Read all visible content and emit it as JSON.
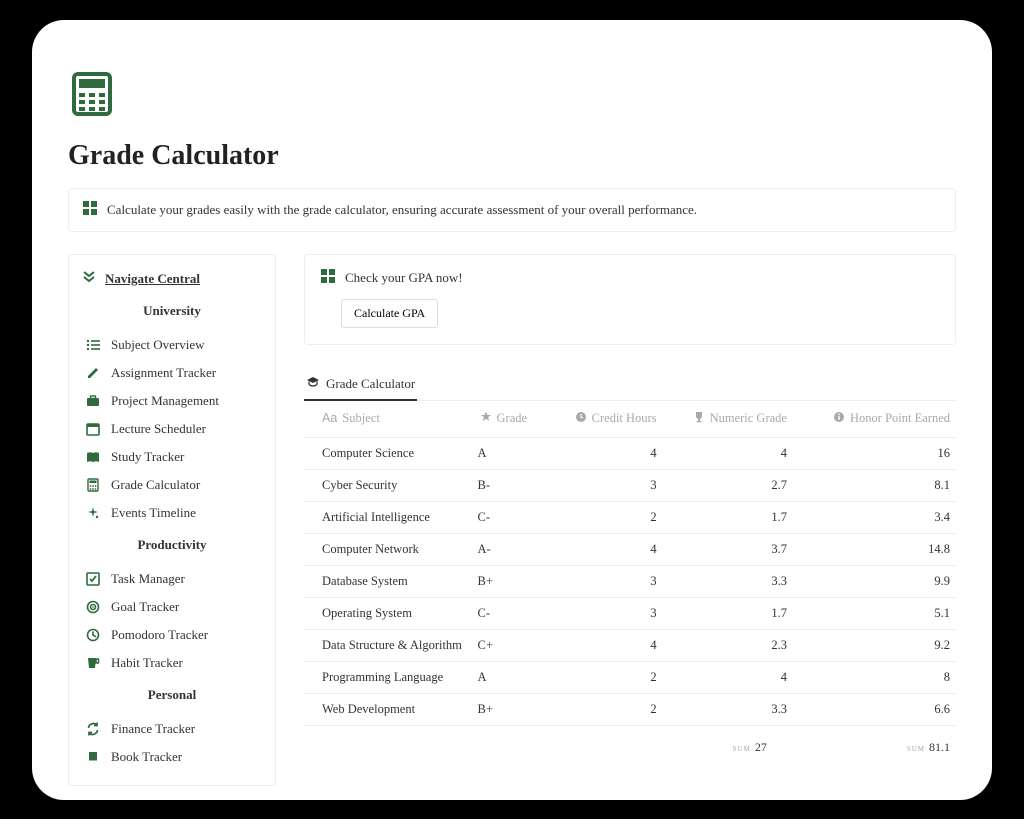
{
  "page": {
    "title": "Grade Calculator",
    "callout": "Calculate your grades easily with the grade calculator, ensuring accurate assessment of your overall performance."
  },
  "sidebar": {
    "title": "Navigate Central",
    "sections": {
      "university": {
        "label": "University",
        "items": [
          {
            "label": "Subject Overview"
          },
          {
            "label": "Assignment Tracker"
          },
          {
            "label": "Project Management"
          },
          {
            "label": "Lecture Scheduler"
          },
          {
            "label": "Study Tracker"
          },
          {
            "label": "Grade Calculator"
          },
          {
            "label": "Events Timeline"
          }
        ]
      },
      "productivity": {
        "label": "Productivity",
        "items": [
          {
            "label": "Task Manager"
          },
          {
            "label": "Goal Tracker"
          },
          {
            "label": "Pomodoro Tracker"
          },
          {
            "label": "Habit Tracker"
          }
        ]
      },
      "personal": {
        "label": "Personal",
        "items": [
          {
            "label": "Finance Tracker"
          },
          {
            "label": "Book Tracker"
          }
        ]
      }
    }
  },
  "gpa": {
    "prompt": "Check your GPA now!",
    "button": "Calculate GPA"
  },
  "table": {
    "tab": "Grade Calculator",
    "columns": {
      "subject": "Subject",
      "grade": "Grade",
      "credit_hours": "Credit Hours",
      "numeric_grade": "Numeric Grade",
      "honor_point": "Honor Point Earned"
    },
    "rows": [
      {
        "subject": "Computer Science",
        "grade": "A",
        "credit_hours": "4",
        "numeric_grade": "4",
        "honor_point": "16"
      },
      {
        "subject": "Cyber Security",
        "grade": "B-",
        "credit_hours": "3",
        "numeric_grade": "2.7",
        "honor_point": "8.1"
      },
      {
        "subject": "Artificial Intelligence",
        "grade": "C-",
        "credit_hours": "2",
        "numeric_grade": "1.7",
        "honor_point": "3.4"
      },
      {
        "subject": "Computer Network",
        "grade": "A-",
        "credit_hours": "4",
        "numeric_grade": "3.7",
        "honor_point": "14.8"
      },
      {
        "subject": "Database System",
        "grade": "B+",
        "credit_hours": "3",
        "numeric_grade": "3.3",
        "honor_point": "9.9"
      },
      {
        "subject": "Operating System",
        "grade": "C-",
        "credit_hours": "3",
        "numeric_grade": "1.7",
        "honor_point": "5.1"
      },
      {
        "subject": "Data Structure & Algorithm",
        "grade": "C+",
        "credit_hours": "4",
        "numeric_grade": "2.3",
        "honor_point": "9.2"
      },
      {
        "subject": "Programming Language",
        "grade": "A",
        "credit_hours": "2",
        "numeric_grade": "4",
        "honor_point": "8"
      },
      {
        "subject": "Web Development",
        "grade": "B+",
        "credit_hours": "2",
        "numeric_grade": "3.3",
        "honor_point": "6.6"
      }
    ],
    "sums": {
      "label": "sum",
      "credit_hours": "27",
      "honor_point": "81.1"
    }
  }
}
